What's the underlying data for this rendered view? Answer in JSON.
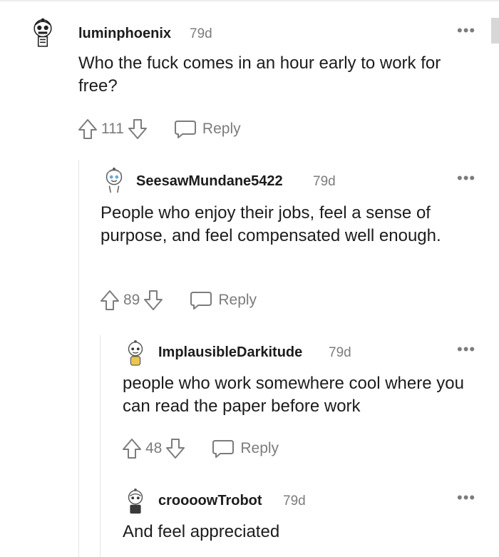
{
  "comments": [
    {
      "username": "luminphoenix",
      "age": "79d",
      "body": "Who the fuck comes in an hour early to work for free?",
      "score": "111",
      "reply_label": "Reply",
      "more_icon": "more-dots-icon"
    },
    {
      "username": "SeesawMundane5422",
      "age": "79d",
      "body": "People who enjoy their jobs, feel a sense of purpose, and feel compensated well enough.",
      "score": "89",
      "reply_label": "Reply",
      "more_icon": "more-dots-icon"
    },
    {
      "username": "ImplausibleDarkitude",
      "age": "79d",
      "body": "people who work somewhere cool where you can read the paper before work",
      "score": "48",
      "reply_label": "Reply",
      "more_icon": "more-dots-icon"
    },
    {
      "username": "croooowTrobot",
      "age": "79d",
      "body": "And feel appreciated",
      "more_icon": "more-dots-icon"
    }
  ],
  "icons": {
    "upvote": "upvote-arrow-icon",
    "downvote": "downvote-arrow-icon",
    "reply": "speech-bubble-icon"
  },
  "colors": {
    "muted": "#7c7c7c",
    "text": "#1c1c1c",
    "thread_line": "#e5e5e5"
  }
}
